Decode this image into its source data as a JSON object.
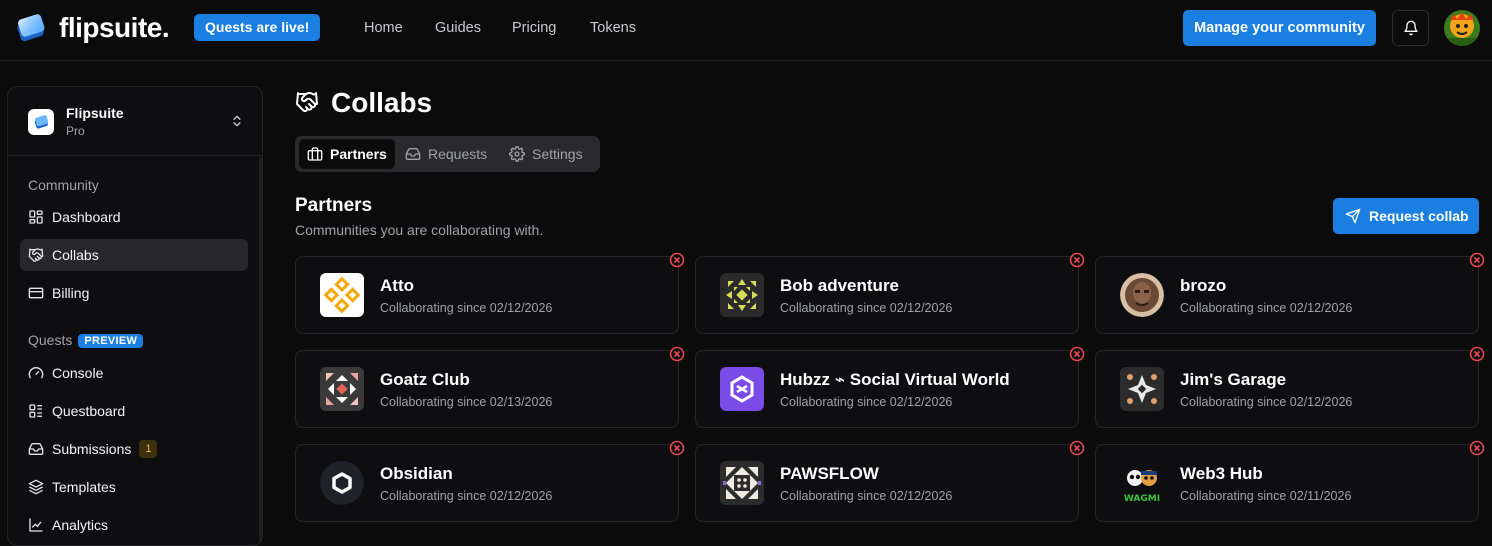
{
  "topbar": {
    "brand": "flipsuite.",
    "promo": "Quests are live!",
    "nav": [
      "Home",
      "Guides",
      "Pricing",
      "Tokens"
    ],
    "cta": "Manage your community"
  },
  "sidebar": {
    "workspace": {
      "name": "Flipsuite",
      "plan": "Pro"
    },
    "community_label": "Community",
    "community_items": [
      {
        "label": "Dashboard",
        "icon": "dashboard-icon"
      },
      {
        "label": "Collabs",
        "icon": "handshake-icon",
        "active": true
      },
      {
        "label": "Billing",
        "icon": "credit-card-icon"
      }
    ],
    "quests_label": "Quests",
    "quests_badge": "PREVIEW",
    "quests_items": [
      {
        "label": "Console",
        "icon": "gauge-icon"
      },
      {
        "label": "Questboard",
        "icon": "list-icon"
      },
      {
        "label": "Submissions",
        "icon": "inbox-icon",
        "count": "1"
      },
      {
        "label": "Templates",
        "icon": "layers-icon"
      },
      {
        "label": "Analytics",
        "icon": "chart-icon"
      }
    ]
  },
  "page": {
    "title": "Collabs",
    "tabs": [
      "Partners",
      "Requests",
      "Settings"
    ],
    "section_title": "Partners",
    "section_subtitle": "Communities you are collaborating with.",
    "request_button": "Request collab"
  },
  "partners": [
    {
      "name": "Atto",
      "since": "Collaborating since 02/12/2026"
    },
    {
      "name": "Bob adventure",
      "since": "Collaborating since 02/12/2026"
    },
    {
      "name": "brozo",
      "since": "Collaborating since 02/12/2026"
    },
    {
      "name": "Goatz Club",
      "since": "Collaborating since 02/13/2026"
    },
    {
      "name": "Hubzz ⌁ Social Virtual World",
      "since": "Collaborating since 02/12/2026"
    },
    {
      "name": "Jim's Garage",
      "since": "Collaborating since 02/12/2026"
    },
    {
      "name": "Obsidian",
      "since": "Collaborating since 02/12/2026"
    },
    {
      "name": "PAWSFLOW",
      "since": "Collaborating since 02/12/2026"
    },
    {
      "name": "Web3 Hub",
      "since": "Collaborating since 02/11/2026",
      "logo_text": "WAGMI"
    }
  ],
  "colors": {
    "accent": "#1a7fe0",
    "remove": "#e5484d"
  }
}
